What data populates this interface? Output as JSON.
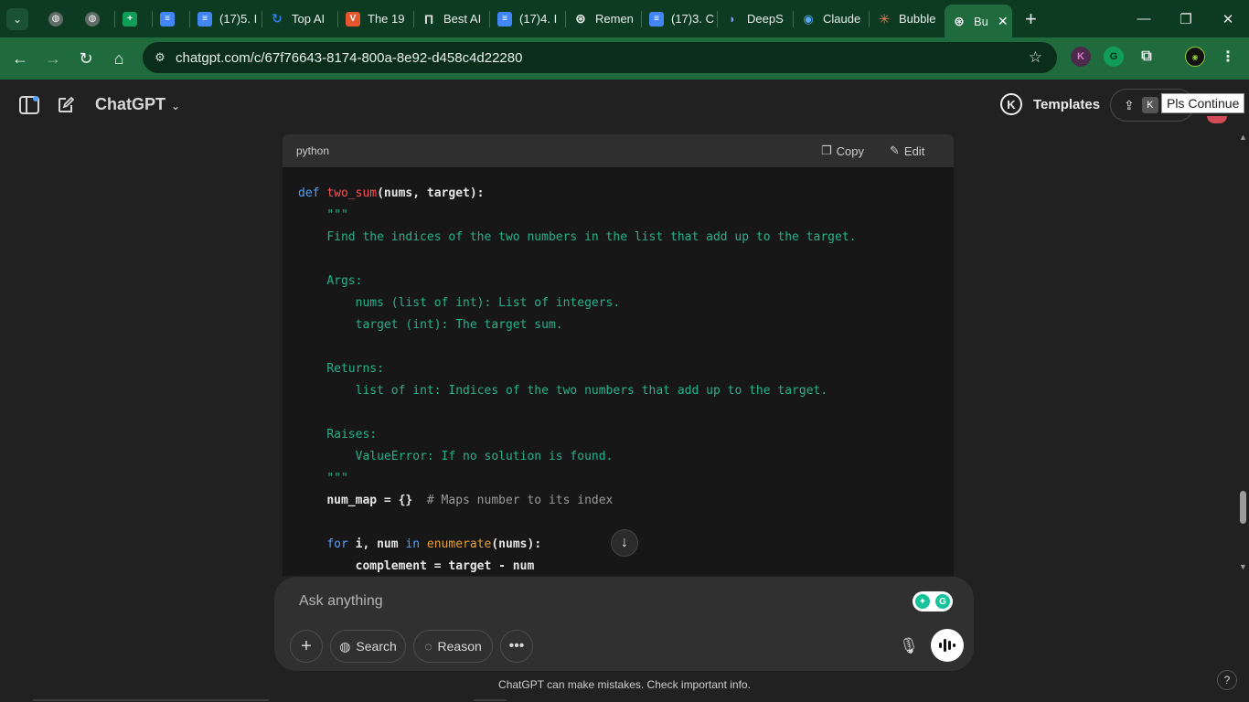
{
  "browser": {
    "tabs": [
      {
        "label": "",
        "icon": "globe-icon",
        "color": "#5f6b66"
      },
      {
        "label": "",
        "icon": "globe-icon",
        "color": "#5f6b66"
      },
      {
        "label": "",
        "icon": "sheets-icon",
        "color": "#0f9d58"
      },
      {
        "label": "",
        "icon": "docs-icon",
        "color": "#4285f4"
      },
      {
        "label": "(17)5. I",
        "icon": "docs-icon",
        "color": "#4285f4"
      },
      {
        "label": "Top AI",
        "icon": "loop-icon",
        "color": "#2b7de9"
      },
      {
        "label": "The 19",
        "icon": "brand-icon",
        "color": "#e4572e"
      },
      {
        "label": "Best AI",
        "icon": "pillar-icon",
        "color": "#888888"
      },
      {
        "label": "(17)4. I",
        "icon": "docs-icon",
        "color": "#4285f4"
      },
      {
        "label": "Remen",
        "icon": "openai-icon",
        "color": "#dddddd"
      },
      {
        "label": "(17)3. C",
        "icon": "docs-icon",
        "color": "#4285f4"
      },
      {
        "label": "DeepS",
        "icon": "deepseek-icon",
        "color": "#4d6bfe"
      },
      {
        "label": "Claude",
        "icon": "claude-icon",
        "color": "#3a8fd9"
      },
      {
        "label": "Bubble",
        "icon": "spark-icon",
        "color": "#d97757"
      },
      {
        "label": "Bu",
        "icon": "openai-icon",
        "color": "#dddddd",
        "active": true
      }
    ],
    "url": "chatgpt.com/c/67f76643-8174-800a-8e92-d458c4d22280"
  },
  "header": {
    "title": "ChatGPT",
    "templates_label": "Templates",
    "templates_badge": "K",
    "share_badge": "K",
    "tooltip": "Pls Continue"
  },
  "codeblock": {
    "language": "python",
    "copy_label": "Copy",
    "edit_label": "Edit"
  },
  "composer": {
    "placeholder": "Ask anything",
    "search_label": "Search",
    "reason_label": "Reason"
  },
  "footer": {
    "disclaimer": "ChatGPT can make mistakes. Check important info.",
    "help": "?"
  },
  "colors": {
    "browser_frame": "#0d3b22",
    "browser_toolbar": "#1f6b3e",
    "page_bg": "#212121",
    "code_bg": "#171717",
    "keyword": "#4ea1ff",
    "function_name": "#f5535a",
    "docstring": "#28b08a",
    "comment": "#9a9a9a",
    "builtin": "#e6a03c"
  }
}
